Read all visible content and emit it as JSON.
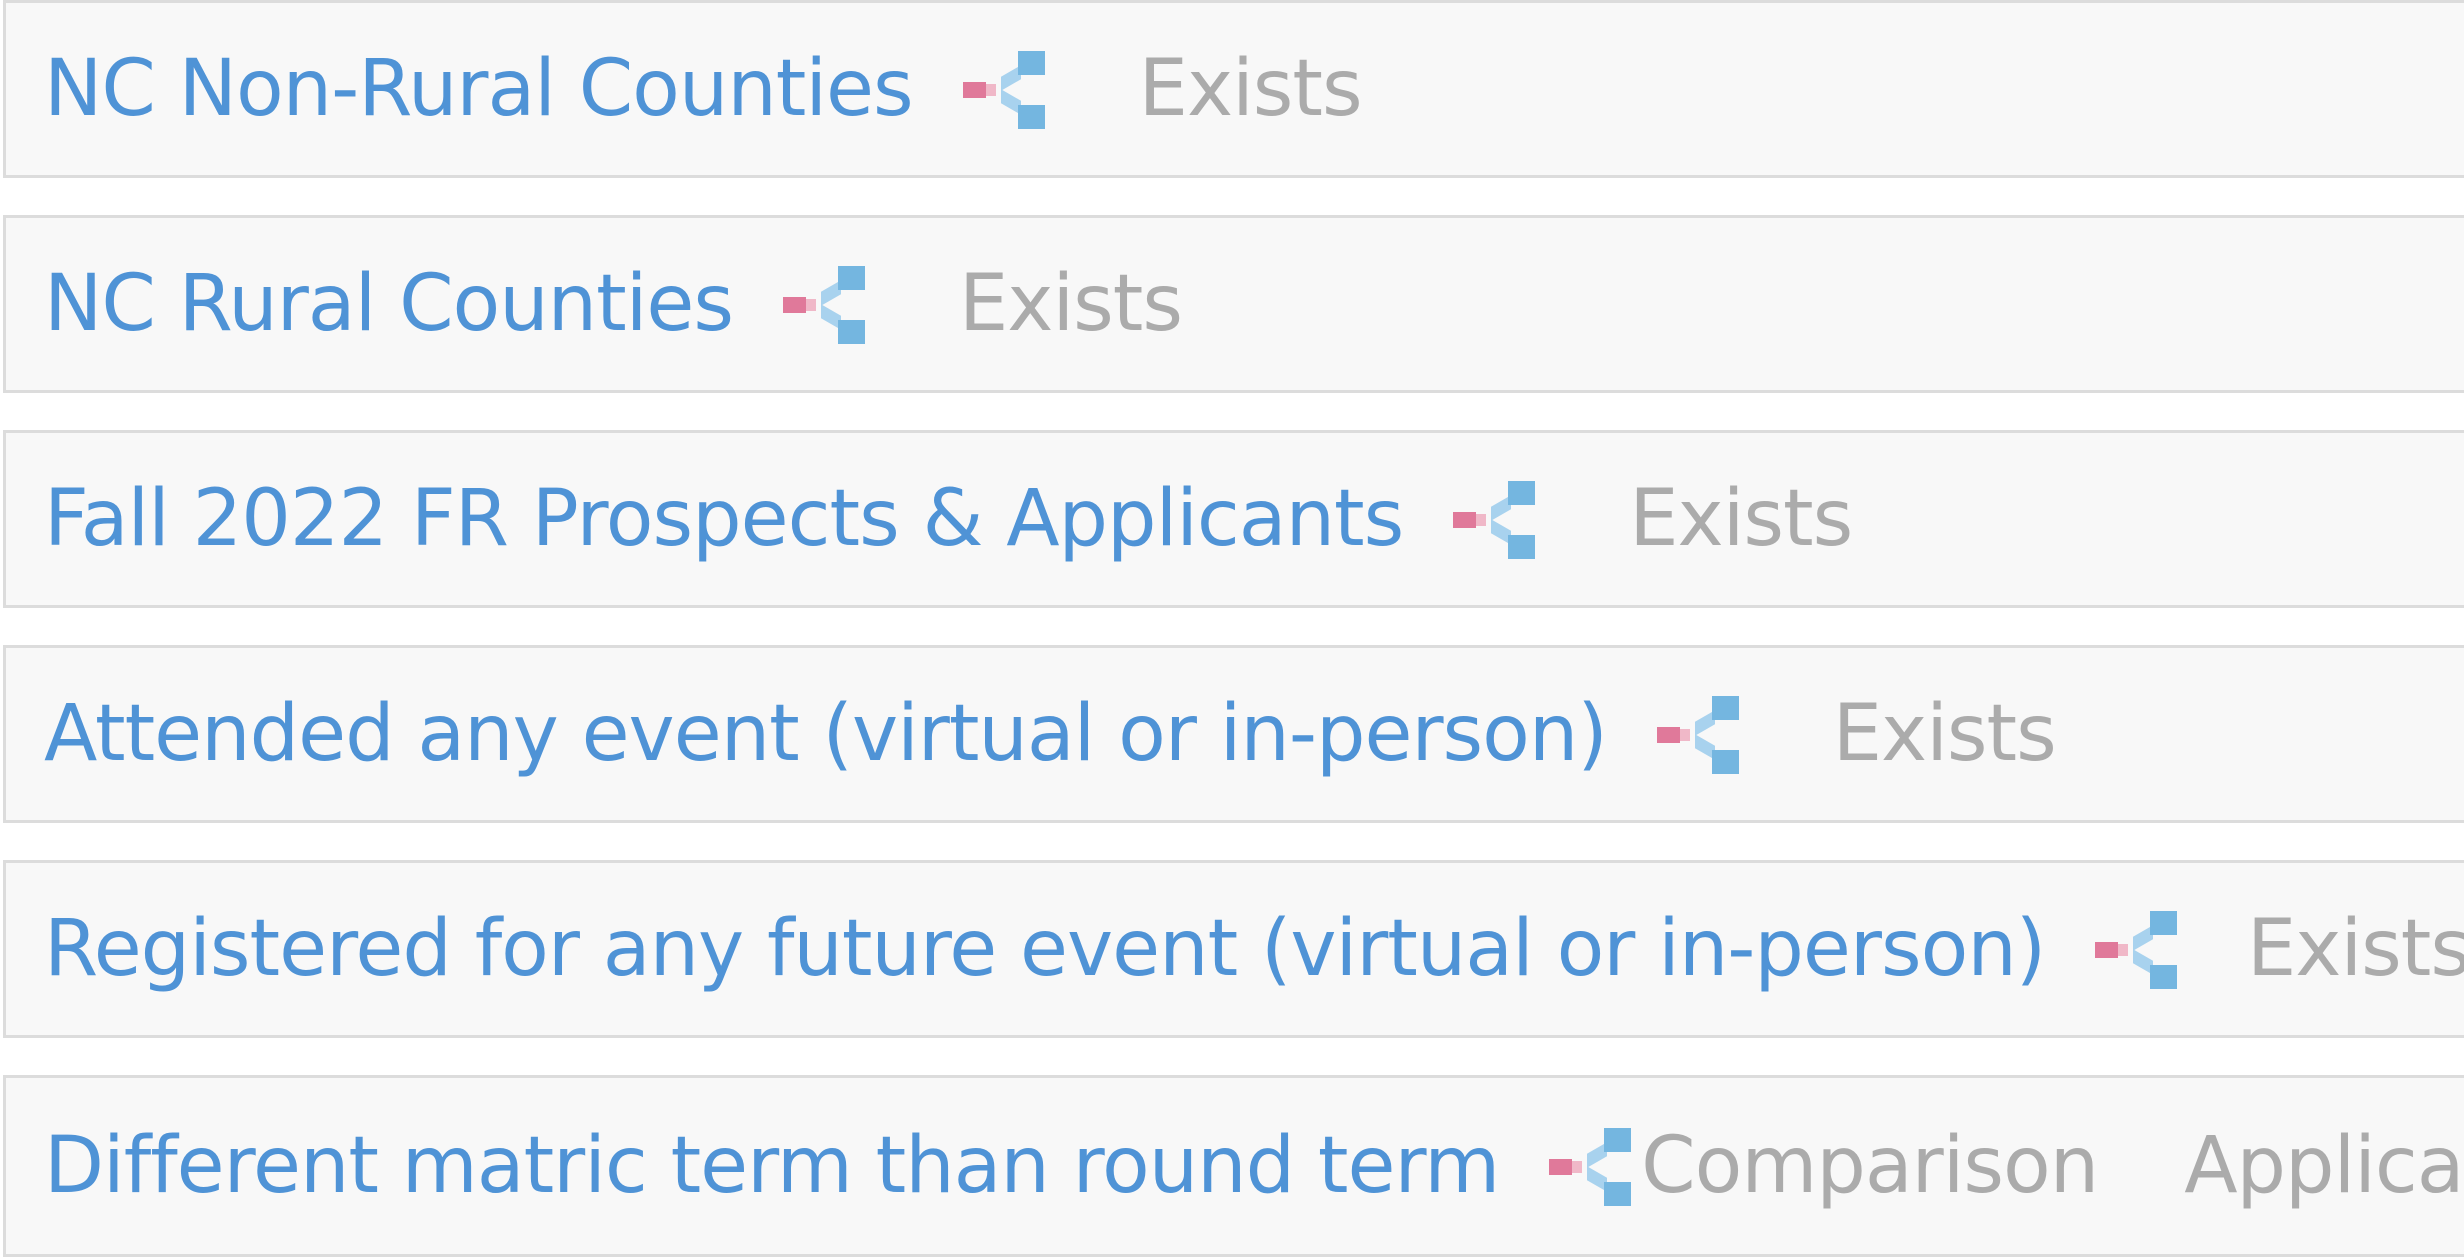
{
  "rows": [
    {
      "name": "NC Non-Rural Counties",
      "icon": "share-icon",
      "type": "Exists"
    },
    {
      "name": "NC Rural Counties",
      "icon": "share-icon",
      "type": "Exists"
    },
    {
      "name": "Fall 2022 FR Prospects & Applicants",
      "icon": "share-icon",
      "type": "Exists"
    },
    {
      "name": "Attended any event (virtual or in-person)",
      "icon": "share-icon",
      "type": "Exists"
    },
    {
      "name": "Registered for any future event (virtual or in-person)",
      "icon": "share-icon",
      "type": "Exists"
    },
    {
      "name": "Different matric term than round term",
      "icon": "share-icon",
      "type": "Comparison",
      "base": "Applicati"
    }
  ],
  "colors": {
    "name": "#4f93d6",
    "type": "#ababab",
    "row_bg": "#f8f8f8",
    "row_border": "#dcdcdc",
    "icon_pink": "#e0799a",
    "icon_blue": "#74b6e0"
  }
}
